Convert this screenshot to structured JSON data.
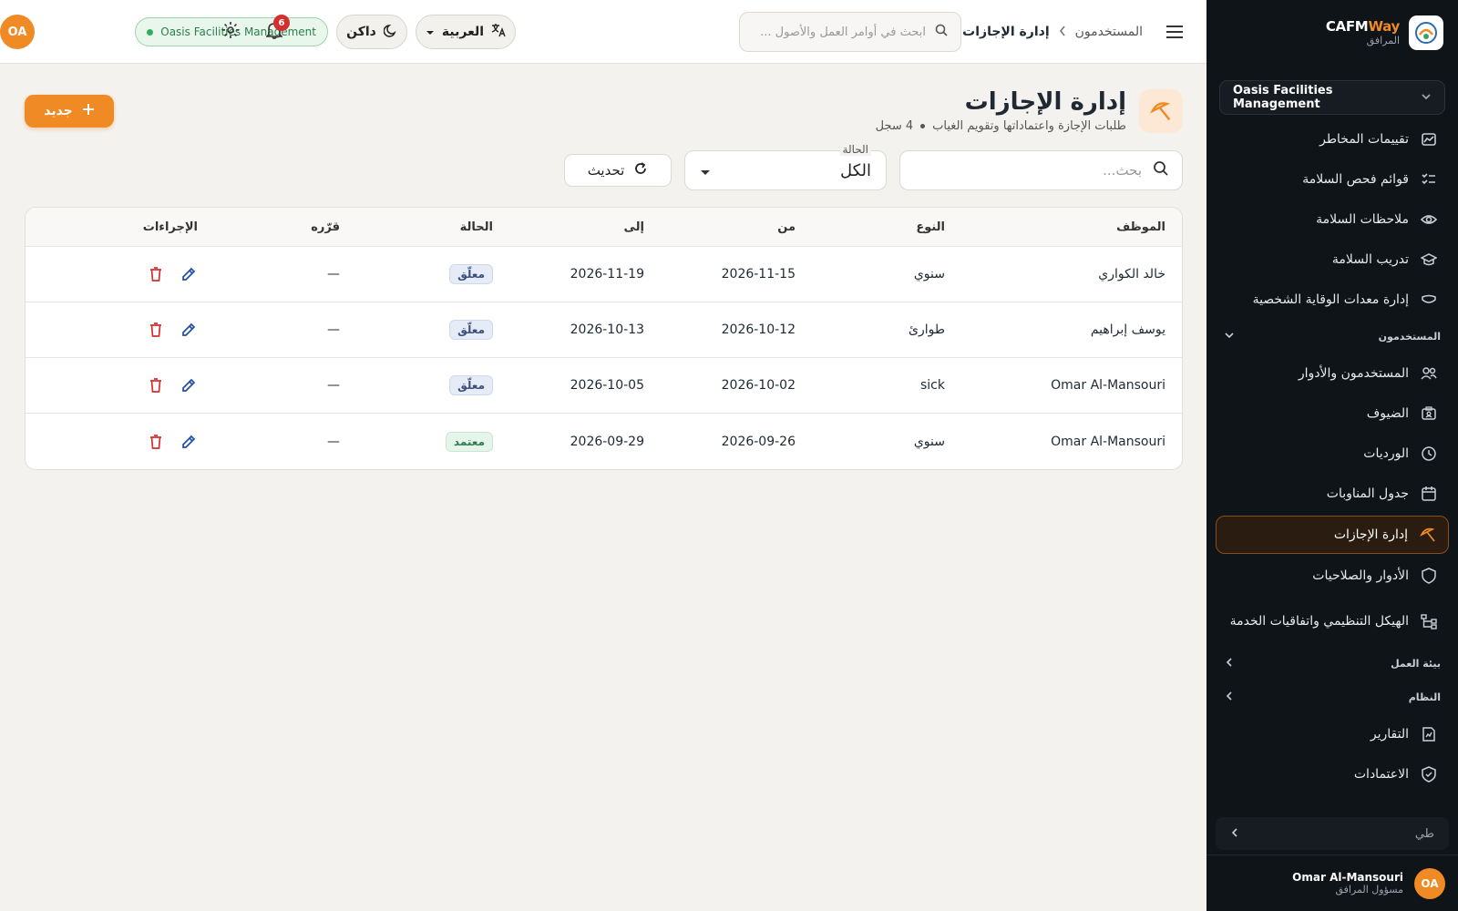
{
  "brand": {
    "name_main": "CAFM",
    "name_accent": "Way",
    "subtitle": "المرافق"
  },
  "sidebar": {
    "org_selector": "Oasis Facilities Management",
    "items_top": [
      {
        "label": "تقييمات المخاطر",
        "icon": "risk-chart-icon"
      },
      {
        "label": "قوائم فحص السلامة",
        "icon": "checklist-icon"
      },
      {
        "label": "ملاحظات السلامة",
        "icon": "eye-icon"
      },
      {
        "label": "تدريب السلامة",
        "icon": "graduation-cap-icon"
      },
      {
        "label": "إدارة معدات الوقاية الشخصية",
        "icon": "mask-icon"
      }
    ],
    "section_users": "المستخدمون",
    "items_users": [
      {
        "label": "المستخدمون والأدوار",
        "icon": "users-icon"
      },
      {
        "label": "الضيوف",
        "icon": "guest-badge-icon"
      },
      {
        "label": "الورديات",
        "icon": "clock-icon"
      },
      {
        "label": "جدول المناوبات",
        "icon": "calendar-icon"
      },
      {
        "label": "إدارة الإجازات",
        "icon": "beach-umbrella-icon",
        "active": true
      },
      {
        "label": "الأدوار والصلاحيات",
        "icon": "shield-icon"
      },
      {
        "label": "الهيكل التنظيمي واتفاقيات الخدمة",
        "icon": "org-tree-icon"
      }
    ],
    "section_workenv": "بيئة العمل",
    "section_system": "النظام",
    "items_bottom": [
      {
        "label": "التقارير",
        "icon": "report-icon"
      },
      {
        "label": "الاعتمادات",
        "icon": "verified-shield-icon"
      }
    ],
    "collapse_label": "طي",
    "user": {
      "initials": "OA",
      "name": "Omar Al-Mansouri",
      "role": "مسؤول المرافق"
    }
  },
  "topbar": {
    "breadcrumb_parent": "المستخدمون",
    "breadcrumb_current": "إدارة الإجازات",
    "search_placeholder": "ابحث في أوامر العمل والأصول ...",
    "language": "العربية",
    "theme": "داكن",
    "org_badge": "Oasis Facilities Management",
    "notifications_count": "6",
    "avatar_initials": "OA"
  },
  "page": {
    "title": "إدارة الإجازات",
    "subtitle": "طلبات الإجازة واعتماداتها وتقويم الغياب",
    "record_count": "4 سجل",
    "new_button": "جديد"
  },
  "filters": {
    "search_placeholder": "بحث...",
    "status_label": "الحالة",
    "status_value": "الكل",
    "refresh_label": "تحديث"
  },
  "table": {
    "headers": {
      "employee": "الموظف",
      "type": "النوع",
      "from": "من",
      "to": "إلى",
      "status": "الحالة",
      "decision": "قرّره",
      "actions": "الإجراءات"
    },
    "rows": [
      {
        "employee": "خالد الكواري",
        "type": "سنوي",
        "from": "2026-11-15",
        "to": "2026-11-19",
        "status": "معلّق",
        "status_kind": "pending",
        "decision": "—"
      },
      {
        "employee": "يوسف إبراهيم",
        "type": "طوارئ",
        "from": "2026-10-12",
        "to": "2026-10-13",
        "status": "معلّق",
        "status_kind": "pending",
        "decision": "—"
      },
      {
        "employee": "Omar Al-Mansouri",
        "type": "sick",
        "from": "2026-10-02",
        "to": "2026-10-05",
        "status": "معلّق",
        "status_kind": "pending",
        "decision": "—"
      },
      {
        "employee": "Omar Al-Mansouri",
        "type": "سنوي",
        "from": "2026-09-26",
        "to": "2026-09-29",
        "status": "معتمد",
        "status_kind": "approved",
        "decision": "—"
      }
    ]
  },
  "colors": {
    "accent": "#f08a24",
    "sidebar_bg": "#0f1419",
    "page_bg": "#f4f2ef",
    "danger": "#d32f2f",
    "edit": "#1f4fa8",
    "success": "#2e7d4f"
  }
}
